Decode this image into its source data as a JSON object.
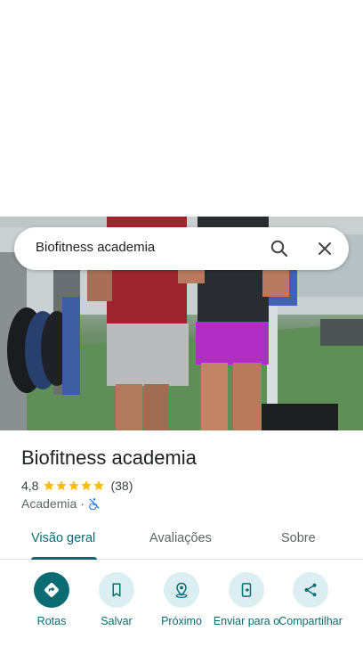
{
  "search": {
    "query": "Biofitness academia",
    "icons": [
      "search-icon",
      "close-icon"
    ]
  },
  "place": {
    "name": "Biofitness academia",
    "rating": "4,8",
    "stars": 5,
    "reviews": "(38)",
    "category": "Academia",
    "separator": "·",
    "accessibility_icon": "no-wheelchair-icon"
  },
  "tabs": [
    {
      "label": "Visão geral",
      "active": true
    },
    {
      "label": "Avaliações",
      "active": false
    },
    {
      "label": "Sobre",
      "active": false
    }
  ],
  "actions": [
    {
      "label": "Rotas",
      "icon": "directions-icon"
    },
    {
      "label": "Salvar",
      "icon": "bookmark-icon"
    },
    {
      "label": "Próximo",
      "icon": "nearby-icon"
    },
    {
      "label": "Enviar para o",
      "icon": "send-to-phone-icon"
    },
    {
      "label": "Compartilhar",
      "icon": "share-icon"
    }
  ],
  "colors": {
    "accent": "#0b6b72",
    "action_bg": "#dbeff2",
    "star": "#fbbc04"
  }
}
